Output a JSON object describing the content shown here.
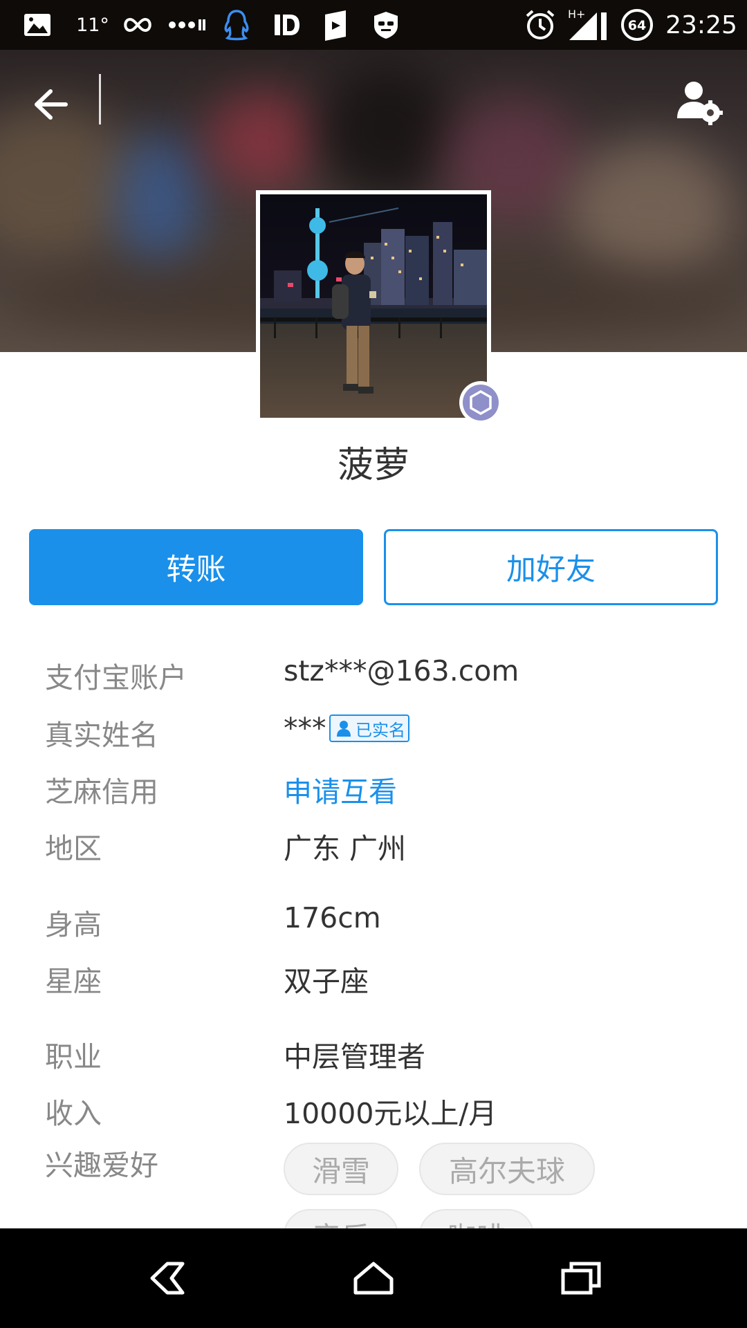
{
  "status_bar": {
    "temperature": "11°",
    "battery_level": "64",
    "time": "23:25",
    "network": "H+",
    "icons": [
      "gallery-icon",
      "infinity-icon",
      "more-dots-icon",
      "qq-icon",
      "id-icon",
      "book-icon",
      "shield-icon",
      "alarm-icon",
      "signal-icon",
      "battery-icon"
    ]
  },
  "header": {
    "back_icon": "arrow-left-icon",
    "settings_icon": "user-settings-icon"
  },
  "profile": {
    "nickname": "菠萝",
    "badge_icon": "member-level-icon"
  },
  "actions": {
    "transfer_label": "转账",
    "add_friend_label": "加好友"
  },
  "info": {
    "account": {
      "label": "支付宝账户",
      "value": "stz***@163.com"
    },
    "real_name": {
      "label": "真实姓名",
      "value": "***",
      "verified_label": "已实名"
    },
    "credit": {
      "label": "芝麻信用",
      "value": "申请互看"
    },
    "region": {
      "label": "地区",
      "value": "广东 广州"
    },
    "height": {
      "label": "身高",
      "value": "176cm"
    },
    "zodiac": {
      "label": "星座",
      "value": "双子座"
    },
    "occupation": {
      "label": "职业",
      "value": "中层管理者"
    },
    "income": {
      "label": "收入",
      "value": "10000元以上/月"
    },
    "hobbies": {
      "label": "兴趣爱好",
      "tags": [
        "滑雪",
        "高尔夫球",
        "音乐",
        "咖啡"
      ]
    }
  },
  "colors": {
    "accent": "#1a90ea",
    "label_gray": "#888888",
    "text": "#333333"
  },
  "nav": {
    "icons": [
      "back-nav-icon",
      "home-nav-icon",
      "recents-nav-icon"
    ]
  }
}
